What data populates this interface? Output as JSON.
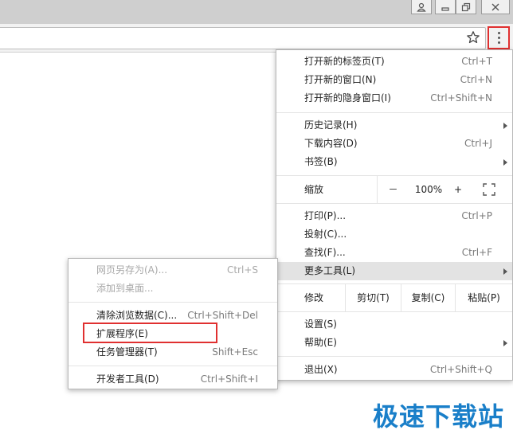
{
  "colors": {
    "highlight_border": "#e03030",
    "watermark": "#1a7fc9",
    "hover_bg": "#e3e3e3"
  },
  "window_controls": {
    "user_icon": "user-icon",
    "minimize_icon": "minimize-icon",
    "restore_icon": "restore-icon",
    "close_icon": "close-icon"
  },
  "toolbar": {
    "bookmark_icon": "star-icon",
    "menu_icon": "three-dots-icon"
  },
  "menu": {
    "new_tab": {
      "label": "打开新的标签页(T)",
      "shortcut": "Ctrl+T"
    },
    "new_window": {
      "label": "打开新的窗口(N)",
      "shortcut": "Ctrl+N"
    },
    "new_incognito": {
      "label": "打开新的隐身窗口(I)",
      "shortcut": "Ctrl+Shift+N"
    },
    "history": {
      "label": "历史记录(H)"
    },
    "downloads": {
      "label": "下载内容(D)",
      "shortcut": "Ctrl+J"
    },
    "bookmarks": {
      "label": "书签(B)"
    },
    "zoom": {
      "label": "缩放",
      "minus": "－",
      "value": "100%",
      "plus": "+"
    },
    "print": {
      "label": "打印(P)...",
      "shortcut": "Ctrl+P"
    },
    "cast": {
      "label": "投射(C)..."
    },
    "find": {
      "label": "查找(F)...",
      "shortcut": "Ctrl+F"
    },
    "more_tools": {
      "label": "更多工具(L)"
    },
    "edit": {
      "label": "修改",
      "cut": "剪切(T)",
      "copy": "复制(C)",
      "paste": "粘贴(P)"
    },
    "settings": {
      "label": "设置(S)"
    },
    "help": {
      "label": "帮助(E)"
    },
    "exit": {
      "label": "退出(X)",
      "shortcut": "Ctrl+Shift+Q"
    }
  },
  "submenu": {
    "save_page": {
      "label": "网页另存为(A)...",
      "shortcut": "Ctrl+S"
    },
    "add_to_desktop": {
      "label": "添加到桌面..."
    },
    "clear_data": {
      "label": "清除浏览数据(C)...",
      "shortcut": "Ctrl+Shift+Del"
    },
    "extensions": {
      "label": "扩展程序(E)"
    },
    "task_manager": {
      "label": "任务管理器(T)",
      "shortcut": "Shift+Esc"
    },
    "dev_tools": {
      "label": "开发者工具(D)",
      "shortcut": "Ctrl+Shift+I"
    }
  },
  "watermark": "极速下载站"
}
